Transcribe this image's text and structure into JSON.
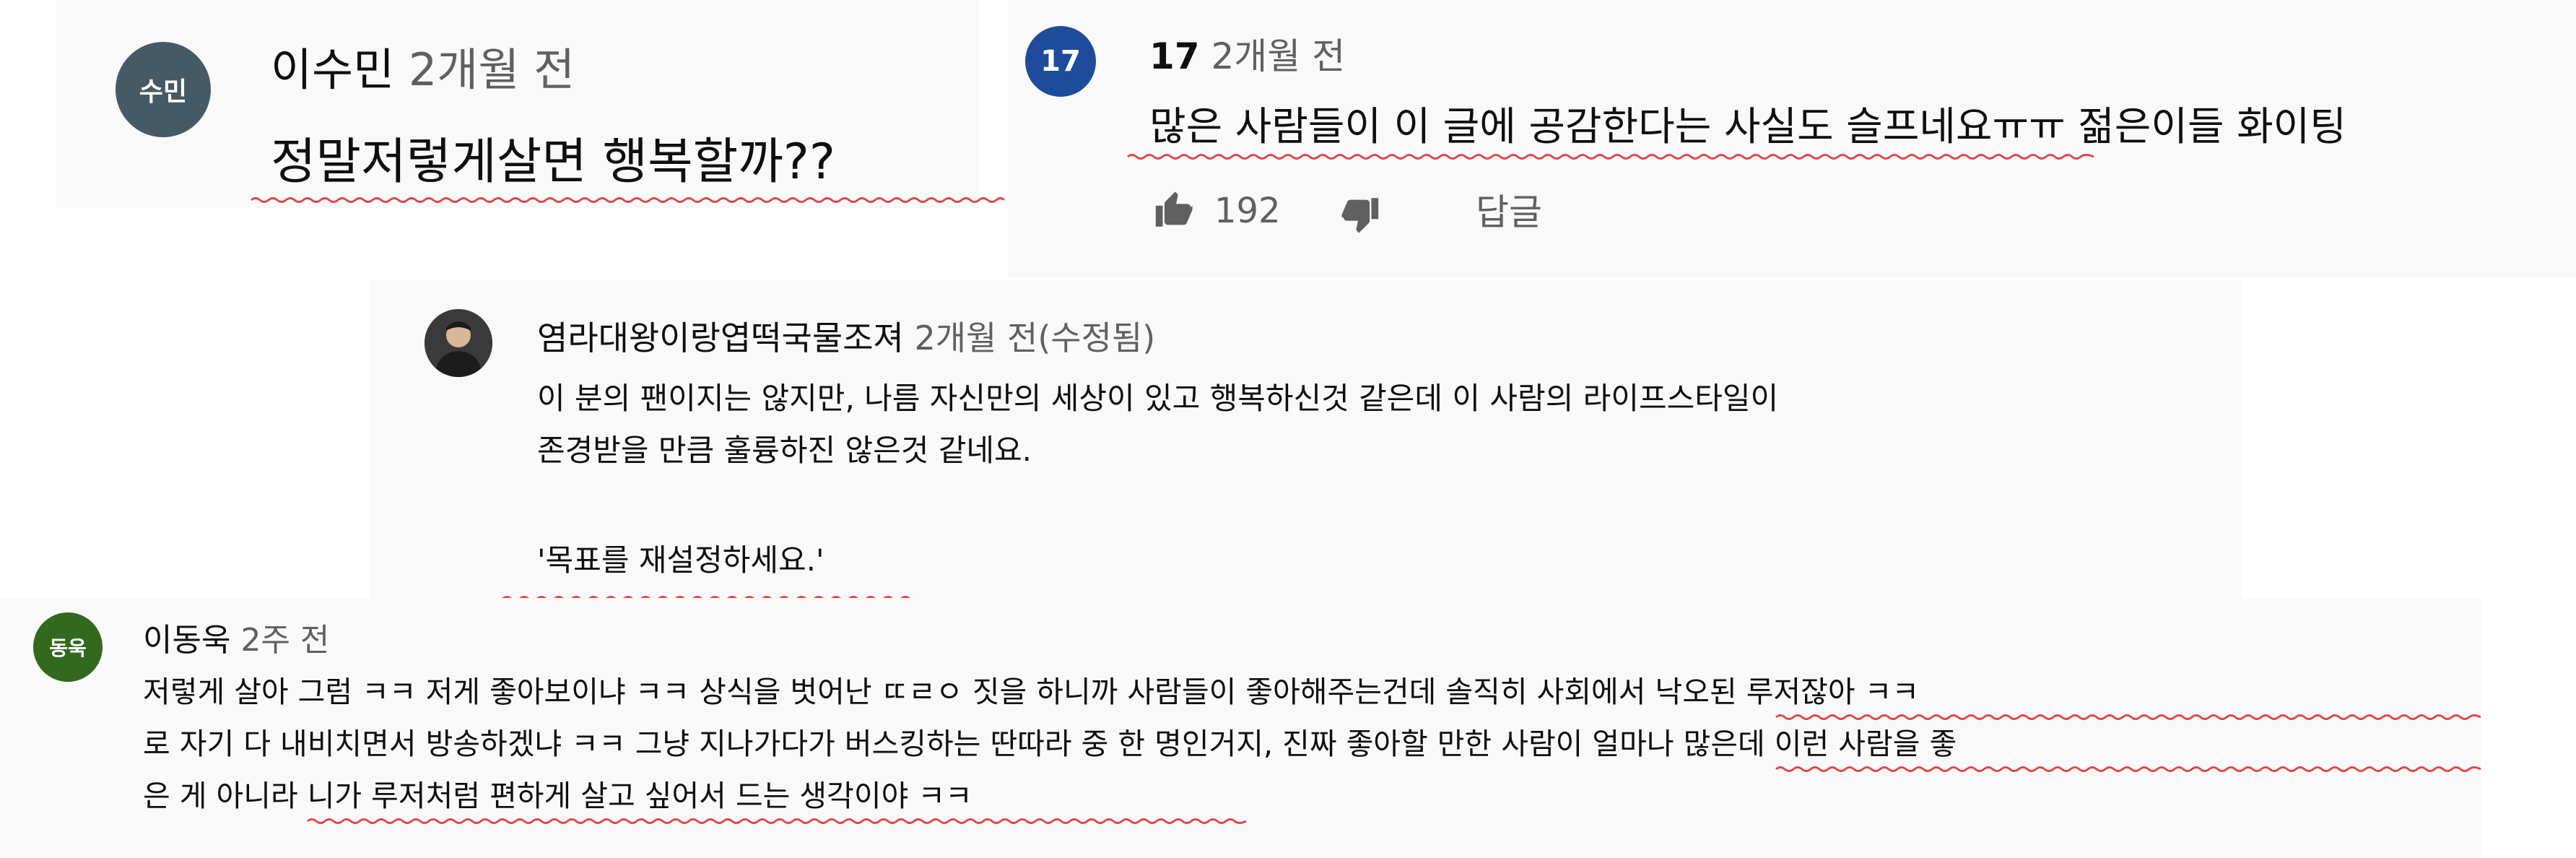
{
  "comments": [
    {
      "avatar_text": "수민",
      "avatar_color": "#455a64",
      "author": "이수민",
      "time": "2개월 전",
      "lines": [
        "정말저렇게살면 행복할까??"
      ]
    },
    {
      "avatar_text": "17",
      "avatar_color": "#1e4c9a",
      "author": "17",
      "time": "2개월 전",
      "lines": [
        "많은 사람들이 이 글에 공감한다는 사실도 슬프네요ㅠㅠ 젊은이들 화이팅"
      ],
      "likes": "192",
      "like_icon": "thumbs-up-icon",
      "dislike_icon": "thumbs-down-icon",
      "reply_label": "답글"
    },
    {
      "avatar_icon": "profile-photo",
      "avatar_color": "#2b2b2b",
      "author": "염라대왕이랑엽떡국물조져",
      "time": "2개월 전(수정됨)",
      "lines": [
        "이 분의 팬이지는 않지만, 나름 자신만의 세상이 있고 행복하신것 같은데 이 사람의 라이프스타일이",
        "존경받을 만큼 훌륭하진 않은것 같네요.",
        "",
        "'목표를 재설정하세요.'"
      ]
    },
    {
      "avatar_text": "동욱",
      "avatar_color": "#33691e",
      "author": "이동욱",
      "time": "2주 전",
      "lines": [
        "저렇게 살아 그럼 ㅋㅋ 저게 좋아보이냐 ㅋㅋ 상식을 벗어난 ㄸㄹㅇ 짓을 하니까 사람들이 좋아해주는건데 솔직히 사회에서 낙오된 루저잖아 ㅋㅋ",
        "로 자기 다 내비치면서 방송하겠냐 ㅋㅋ 그냥 지나가다가 버스킹하는 딴따라 중 한 명인거지, 진짜 좋아할 만한 사람이 얼마나 많은데 이런 사람을 좋",
        "은 게 아니라 니가 루저처럼 편하게 살고 싶어서 드는 생각이야 ㅋㅋ"
      ]
    }
  ],
  "accent_colors": {
    "underline": "#e04848",
    "meta_gray": "#606060",
    "panel": "#f9f9f9"
  }
}
